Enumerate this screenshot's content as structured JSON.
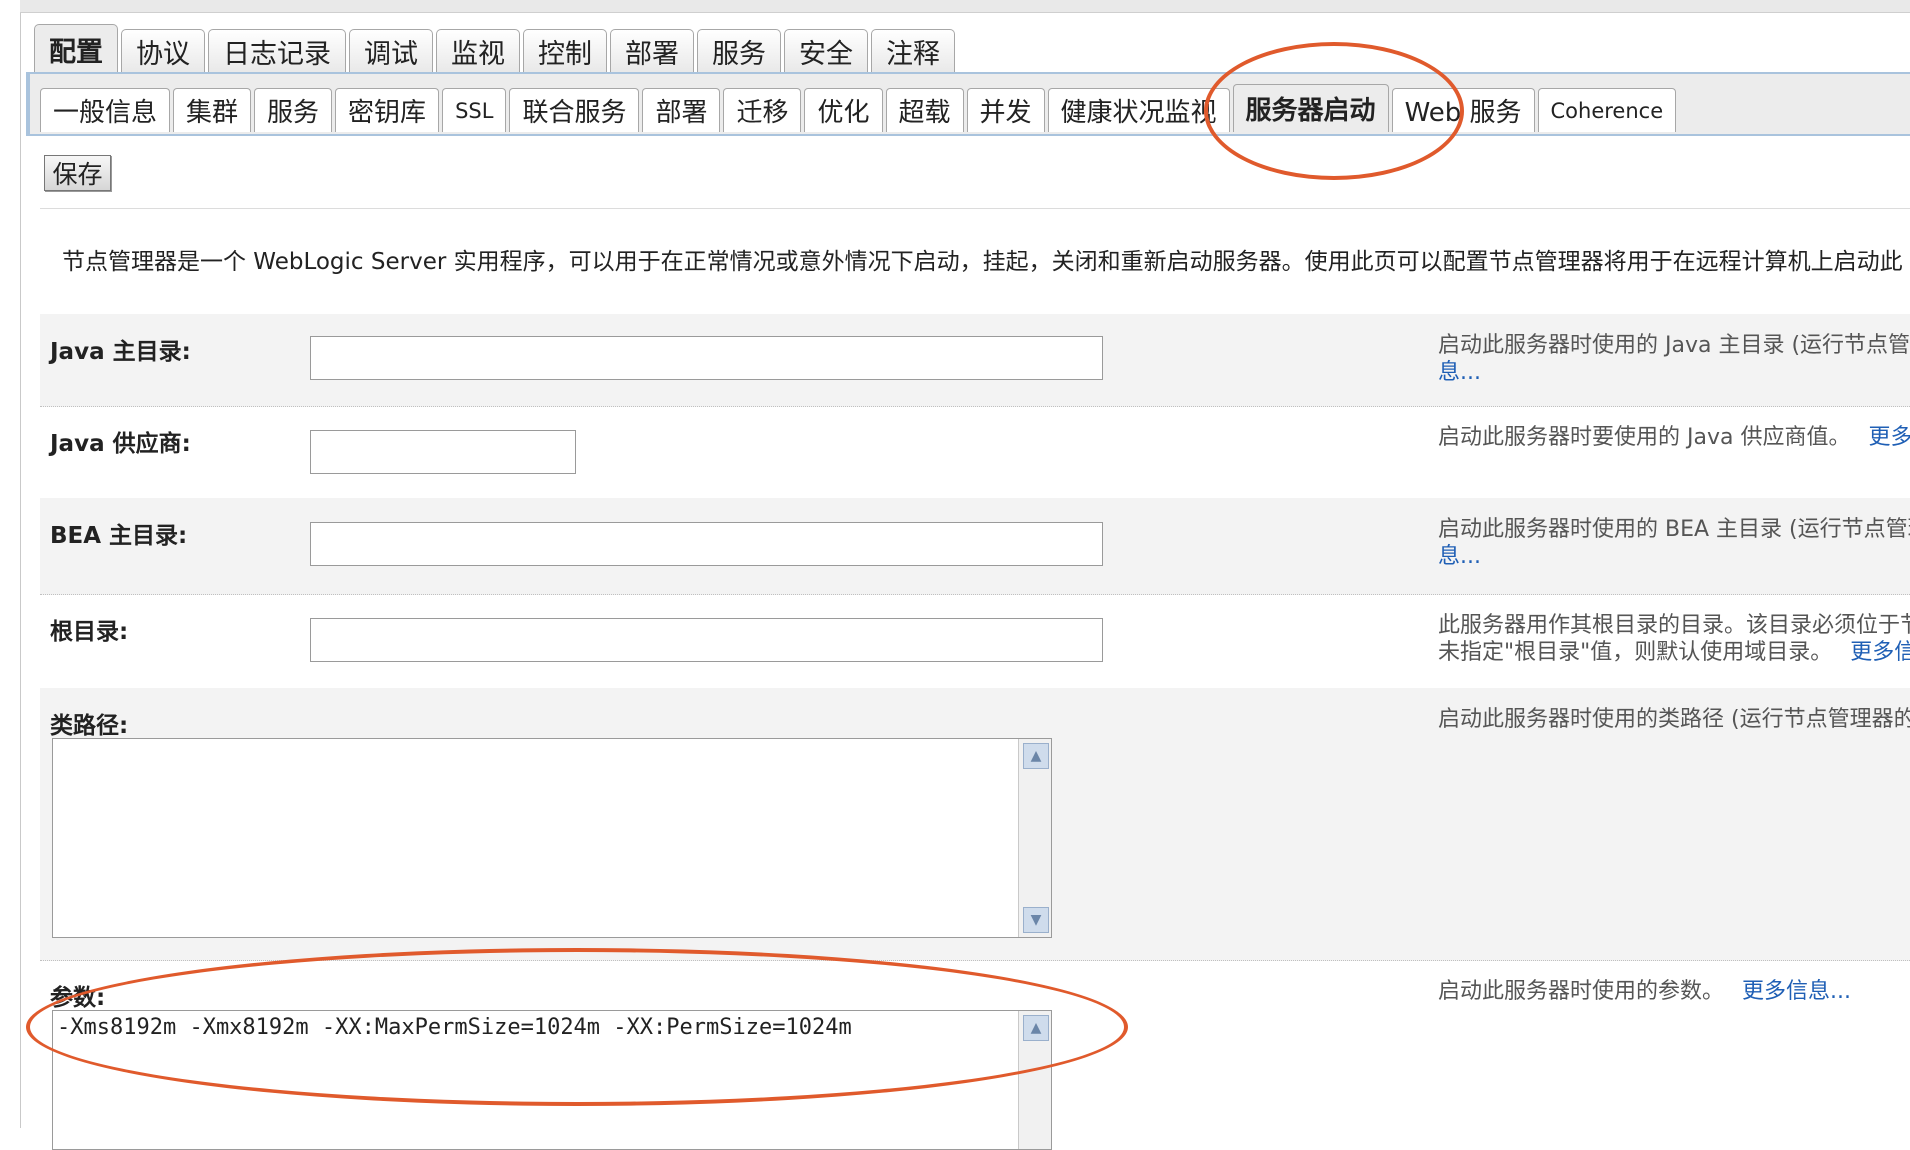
{
  "tabs_main": [
    "配置",
    "协议",
    "日志记录",
    "调试",
    "监视",
    "控制",
    "部署",
    "服务",
    "安全",
    "注释"
  ],
  "tabs_sub": [
    "一般信息",
    "集群",
    "服务",
    "密钥库",
    "SSL",
    "联合服务",
    "部署",
    "迁移",
    "优化",
    "超载",
    "并发",
    "健康状况监视",
    "服务器启动",
    "Web 服务",
    "Coherence"
  ],
  "save_label": "保存",
  "intro_text": "节点管理器是一个 WebLogic Server 实用程序，可以用于在正常情况或意外情况下启动，挂起，关闭和重新启动服务器。使用此页可以配置节点管理器将用于在远程计算机上启动此",
  "fields": {
    "java_home": {
      "label": "Java 主目录:",
      "value": "",
      "help_line1": "启动此服务器时使用的 Java 主目录 (运行节点管理",
      "help_link": "息..."
    },
    "java_vendor": {
      "label": "Java 供应商:",
      "value": "",
      "help_line1": "启动此服务器时要使用的 Java 供应商值。",
      "help_link": "更多"
    },
    "bea_home": {
      "label": "BEA 主目录:",
      "value": "",
      "help_line1": "启动此服务器时使用的 BEA 主目录 (运行节点管理",
      "help_link": "息..."
    },
    "root_dir": {
      "label": "根目录:",
      "value": "",
      "help_line1": "此服务器用作其根目录的目录。该目录必须位于节",
      "help_line2": "未指定\"根目录\"值，则默认使用域目录。",
      "help_link": "更多信息"
    },
    "classpath": {
      "label": "类路径:",
      "value": "",
      "help_line1": "启动此服务器时使用的类路径 (运行节点管理器的"
    },
    "arguments": {
      "label": "参数:",
      "value": "-Xms8192m -Xmx8192m -XX:MaxPermSize=1024m -XX:PermSize=1024m",
      "help_line1": "启动此服务器时使用的参数。",
      "help_link": "更多信息..."
    }
  },
  "colors": {
    "annotation": "#e05a2c",
    "link": "#1f5fb5",
    "tab_border": "#a9c3dd"
  }
}
